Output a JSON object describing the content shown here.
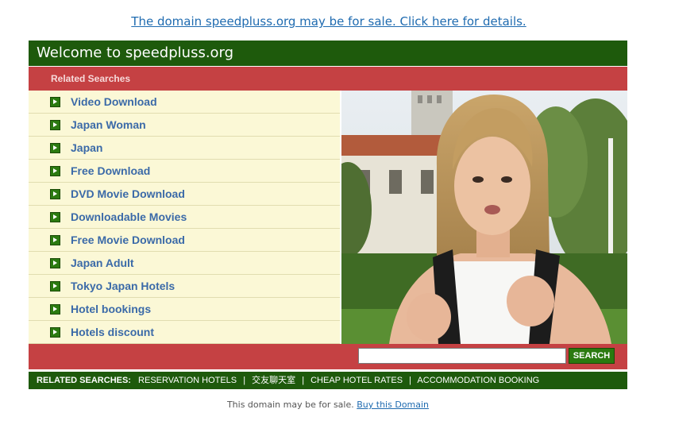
{
  "top_link": "The domain speedpluss.org may be for sale. Click here for details.",
  "header": {
    "title": "Welcome to speedpluss.org"
  },
  "related_title": "Related Searches",
  "related_items": [
    "Video Download",
    "Japan Woman",
    "Japan",
    "Free Download",
    "DVD Movie Download",
    "Downloadable Movies",
    "Free Movie Download",
    "Japan Adult",
    "Tokyo Japan Hotels",
    "Hotel bookings",
    "Hotels discount"
  ],
  "search": {
    "value": "",
    "button_label": "SEARCH"
  },
  "bottom": {
    "label": "RELATED SEARCHES:",
    "links": [
      "RESERVATION HOTELS",
      "交友聊天室",
      "CHEAP HOTEL RATES",
      "ACCOMMODATION BOOKING"
    ],
    "separator": "|"
  },
  "footer": {
    "text": "This domain may be for sale.",
    "link": "Buy this Domain"
  },
  "colors": {
    "header_green": "#1e5a0c",
    "bar_red": "#c54143",
    "list_bg": "#fbf8d6",
    "link_blue": "#3b6aa8"
  }
}
